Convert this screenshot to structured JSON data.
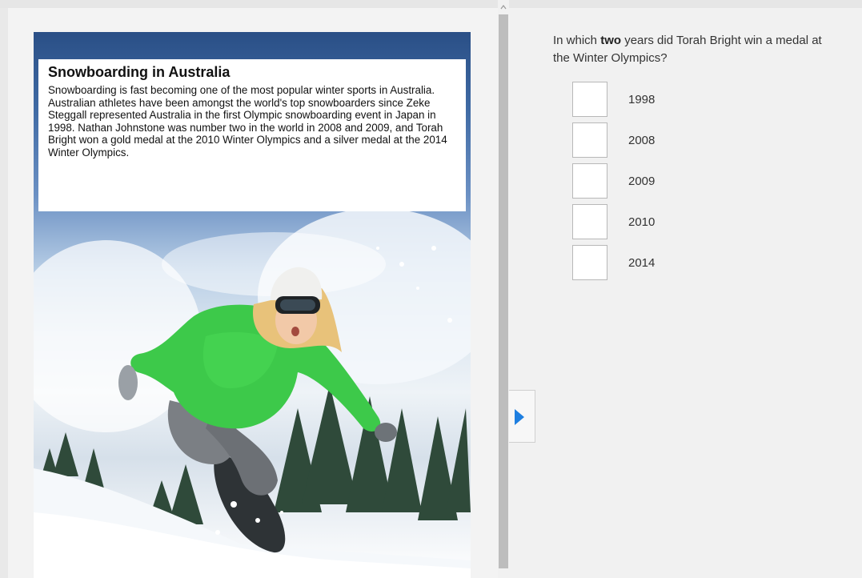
{
  "passage": {
    "title": "Snowboarding in Australia",
    "text": "Snowboarding is fast becoming one of the most popular winter sports in Australia. Australian athletes have been amongst the world's top snowboarders since Zeke Steggall represented Australia in the first Olympic snowboarding event in Japan in 1998. Nathan Johnstone was number two in the world in 2008 and 2009, and Torah Bright won a gold medal at the 2010 Winter Olympics and a silver medal at the 2014 Winter Olympics.",
    "image": "snowboarder-photo"
  },
  "question": {
    "prefix": "In which ",
    "emphasis": "two",
    "suffix": " years did Torah Bright win a medal at the Winter Olympics?"
  },
  "options": [
    {
      "label": "1998",
      "checked": false
    },
    {
      "label": "2008",
      "checked": false
    },
    {
      "label": "2009",
      "checked": false
    },
    {
      "label": "2010",
      "checked": false
    },
    {
      "label": "2014",
      "checked": false
    }
  ],
  "controls": {
    "expand_icon": "triangle-right-icon",
    "splitter_icon": "chevron-up-icon"
  },
  "colors": {
    "accent": "#1e7fe0",
    "jacket": "#3dc94a",
    "sky": "#2a4f86"
  }
}
